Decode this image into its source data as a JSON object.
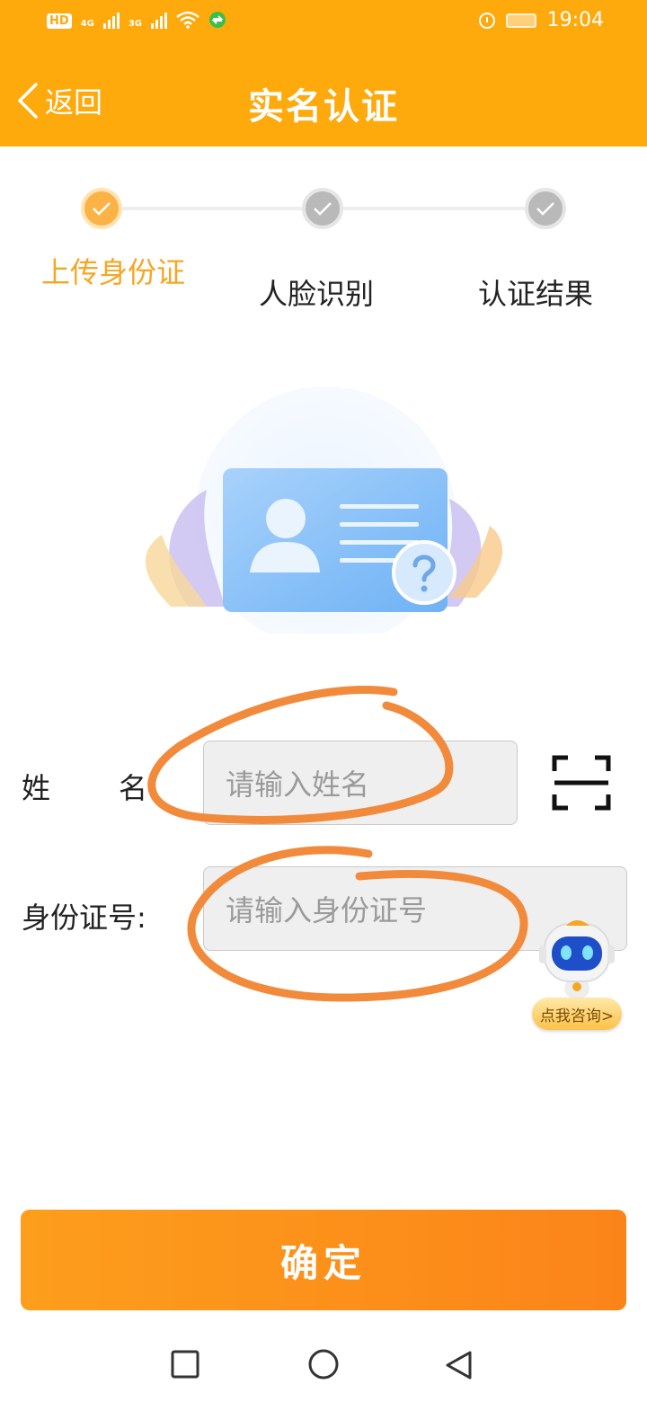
{
  "status_bar": {
    "left_badge": "HD",
    "net1": "4G",
    "net2": "3G",
    "time": "19:04"
  },
  "header": {
    "back_label": "返回",
    "title": "实名认证"
  },
  "steps": [
    {
      "label": "上传身份证",
      "state": "active"
    },
    {
      "label": "人脸识别",
      "state": "inactive"
    },
    {
      "label": "认证结果",
      "state": "inactive"
    }
  ],
  "form": {
    "name_label_1": "姓",
    "name_label_2": "名",
    "name_placeholder": "请输入姓名",
    "id_label": "身份证号:",
    "id_placeholder": "请输入身份证号"
  },
  "assistant": {
    "label": "点我咨询>"
  },
  "confirm_label": "确定",
  "colors": {
    "brand": "#fea90c",
    "active_step": "#f6a623",
    "button": "#fb8f1a",
    "annotation": "#f28a3c"
  },
  "icons": {
    "back": "chevron-left-icon",
    "scan": "scan-frame-icon",
    "nav": [
      "square-recent-icon",
      "circle-home-icon",
      "triangle-back-icon"
    ]
  }
}
